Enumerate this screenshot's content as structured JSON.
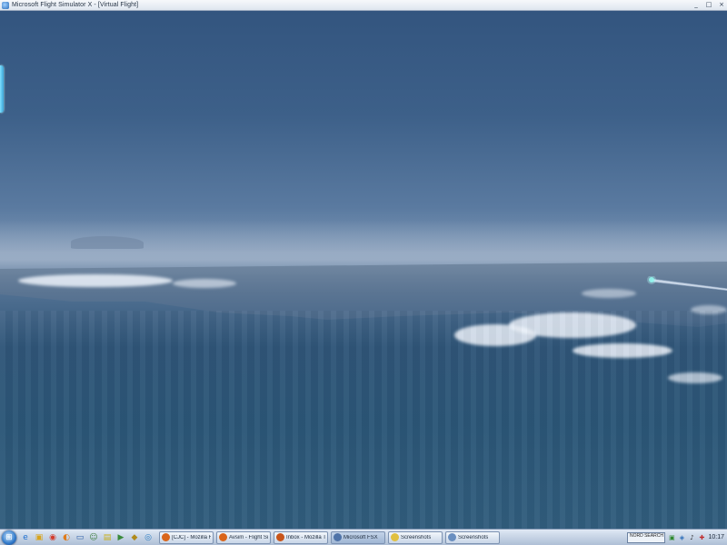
{
  "window": {
    "title": "Microsoft Flight Simulator X - [Virtual Flight]",
    "controls": {
      "minimize": "_",
      "maximize": "□",
      "close": "×"
    }
  },
  "viewport": {
    "scene": "flight-sim-view"
  },
  "taskbar": {
    "start_icon": "start-orb-icon",
    "quick_launch": [
      {
        "icon": "ie-icon",
        "glyph": "e",
        "color": "#1d6fd1"
      },
      {
        "icon": "folder-icon",
        "glyph": "▣",
        "color": "#d8a41d"
      },
      {
        "icon": "chrome-icon",
        "glyph": "◉",
        "color": "#d33b2c"
      },
      {
        "icon": "firefox-icon",
        "glyph": "◐",
        "color": "#e07b1a"
      },
      {
        "icon": "desktop-icon",
        "glyph": "▭",
        "color": "#2d5ea8"
      },
      {
        "icon": "user-icon",
        "glyph": "☺",
        "color": "#3f7f3f"
      },
      {
        "icon": "notes-icon",
        "glyph": "▤",
        "color": "#c9b01a"
      },
      {
        "icon": "media-icon",
        "glyph": "▶",
        "color": "#3a8a3a"
      },
      {
        "icon": "app-icon",
        "glyph": "◆",
        "color": "#b08a1a"
      },
      {
        "icon": "browser-icon",
        "glyph": "◎",
        "color": "#2c7fc4"
      }
    ],
    "tasks": [
      {
        "label": "[CJC] - Mozilla F...",
        "icon_color": "#d9651b",
        "active": false
      },
      {
        "label": "Avsim - Flight Sim...",
        "icon_color": "#d9651b",
        "active": false
      },
      {
        "label": "Inbox - Mozilla Th...",
        "icon_color": "#c8551a",
        "active": false
      },
      {
        "label": "Microsoft FSX",
        "icon_color": "#4f73a8",
        "active": true
      },
      {
        "label": "Screenshots",
        "icon_color": "#e0c040",
        "active": false
      },
      {
        "label": "Screenshots",
        "icon_color": "#6a8fc0",
        "active": false
      }
    ],
    "tray": {
      "box_text": "NORD SEARCH",
      "icons": [
        {
          "icon": "network-icon",
          "glyph": "▣",
          "color": "#2f8a2f"
        },
        {
          "icon": "shield-icon",
          "glyph": "◈",
          "color": "#2a6cb8"
        },
        {
          "icon": "volume-icon",
          "glyph": "♪",
          "color": "#333"
        },
        {
          "icon": "safety-icon",
          "glyph": "✚",
          "color": "#c02a2a"
        }
      ],
      "clock": "10:17"
    }
  }
}
